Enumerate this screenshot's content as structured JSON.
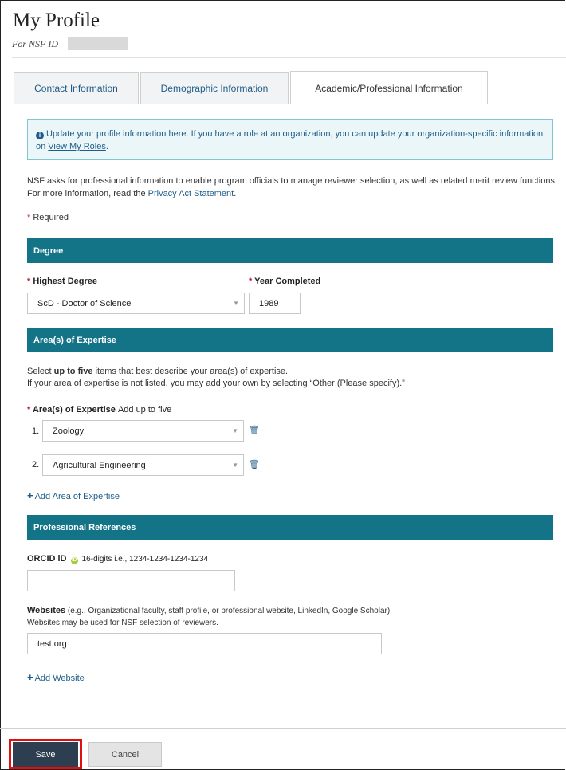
{
  "page": {
    "title": "My Profile",
    "subtitle": "For NSF ID"
  },
  "tabs": [
    {
      "label": "Contact Information"
    },
    {
      "label": "Demographic Information"
    },
    {
      "label": "Academic/Professional Information"
    }
  ],
  "info_box": {
    "text_before": "Update your profile information here. If you have a role at an organization, you can update your organization-specific information on ",
    "link_label": "View My Roles",
    "text_after": "."
  },
  "intro": {
    "text": "NSF asks for professional information to enable program officials to manage reviewer selection, as well as related merit review functions. For more information, read the ",
    "link_label": "Privacy Act Statement",
    "text_after": "."
  },
  "required_note": {
    "star": "*",
    "label": "Required"
  },
  "degree": {
    "section_title": "Degree",
    "highest_degree_label": "Highest Degree",
    "highest_degree_value": "ScD - Doctor of Science",
    "year_label": "Year Completed",
    "year_value": "1989"
  },
  "expertise": {
    "section_title": "Area(s) of Expertise",
    "desc_prefix": "Select ",
    "desc_bold": "up to five",
    "desc_suffix": " items that best describe your area(s) of expertise.",
    "desc_line2": "If your area of expertise is not listed, you may add your own by selecting “Other (Please specify).”",
    "field_label": "Area(s) of Expertise",
    "field_hint": "Add up to five",
    "items": [
      {
        "num": "1.",
        "value": "Zoology"
      },
      {
        "num": "2.",
        "value": "Agricultural Engineering"
      }
    ],
    "add_label": "Add Area of Expertise"
  },
  "references": {
    "section_title": "Professional References",
    "orcid_label": "ORCID iD",
    "orcid_badge": "iD",
    "orcid_hint": "16-digits i.e., 1234-1234-1234-1234",
    "orcid_value": "",
    "websites_label": "Websites",
    "websites_hint": "(e.g., Organizational faculty, staff profile, or professional website, LinkedIn, Google Scholar)",
    "websites_note": "Websites may be used for NSF selection of reviewers.",
    "website_value": "test.org",
    "add_website_label": "Add Website"
  },
  "footer": {
    "save_label": "Save",
    "cancel_label": "Cancel"
  },
  "icons": {
    "info": "info-circle-icon",
    "trash": "trash-icon",
    "plus": "plus-icon",
    "chevron": "chevron-down-icon",
    "orcid": "orcid-icon"
  },
  "colors": {
    "section_header": "#137488",
    "link": "#1f5c8a",
    "required_star": "#c8102e",
    "save_button": "#2c3e50",
    "info_bg": "#eaf6f8",
    "highlight": "#e01010"
  }
}
